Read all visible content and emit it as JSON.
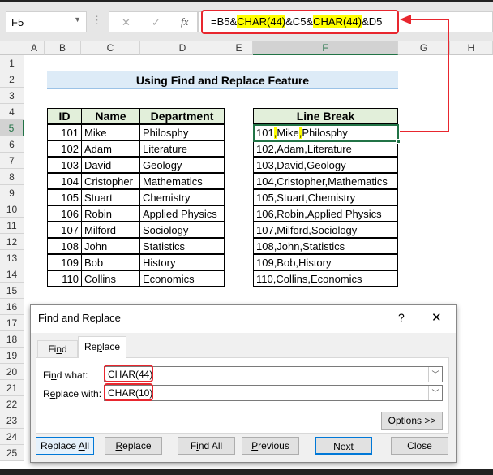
{
  "formula_bar": {
    "name_box": "F5",
    "cancel_icon": "✕",
    "enter_icon": "✓",
    "fx": "fx",
    "formula_parts": [
      "=B5&",
      "CHAR(44)",
      "&C5&",
      "CHAR(44)",
      "&D5"
    ]
  },
  "columns": [
    "A",
    "B",
    "C",
    "D",
    "E",
    "F",
    "G",
    "H"
  ],
  "rows": [
    "1",
    "2",
    "3",
    "4",
    "5",
    "6",
    "7",
    "8",
    "9",
    "10",
    "11",
    "12",
    "13",
    "14",
    "15",
    "16",
    "17",
    "18",
    "19",
    "20",
    "21",
    "22",
    "23",
    "24",
    "25"
  ],
  "title": "Using Find and Replace Feature",
  "table": {
    "headers": [
      "ID",
      "Name",
      "Department"
    ],
    "rows": [
      [
        "101",
        "Mike",
        "Philosphy"
      ],
      [
        "102",
        "Adam",
        "Literature"
      ],
      [
        "103",
        "David",
        "Geology"
      ],
      [
        "104",
        "Cristopher",
        "Mathematics"
      ],
      [
        "105",
        "Stuart",
        "Chemistry"
      ],
      [
        "106",
        "Robin",
        "Applied Physics"
      ],
      [
        "107",
        "Milford",
        "Sociology"
      ],
      [
        "108",
        "John",
        "Statistics"
      ],
      [
        "109",
        "Bob",
        "History"
      ],
      [
        "110",
        "Collins",
        "Economics"
      ]
    ]
  },
  "line_break": {
    "header": "Line Break",
    "first_parts": [
      "101",
      ",",
      "Mike",
      ",",
      "Philosphy"
    ],
    "values": [
      "102,Adam,Literature",
      "103,David,Geology",
      "104,Cristopher,Mathematics",
      "105,Stuart,Chemistry",
      "106,Robin,Applied Physics",
      "107,Milford,Sociology",
      "108,John,Statistics",
      "109,Bob,History",
      "110,Collins,Economics"
    ]
  },
  "dialog": {
    "title": "Find and Replace",
    "help": "?",
    "close_x": "✕",
    "tabs": [
      "Find",
      "Replace"
    ],
    "find_label": "Find what:",
    "find_value": "CHAR(44)",
    "replace_label": "Replace with:",
    "replace_value": "CHAR(10)",
    "options": "Options >>",
    "buttons": [
      "Replace All",
      "Replace",
      "Find All",
      "Previous",
      "Next",
      "Close"
    ]
  },
  "colors": {
    "highlight": "#ffff00",
    "annotation": "#e8262e",
    "header_fill": "#e2efda",
    "title_fill": "#ddebf7"
  }
}
